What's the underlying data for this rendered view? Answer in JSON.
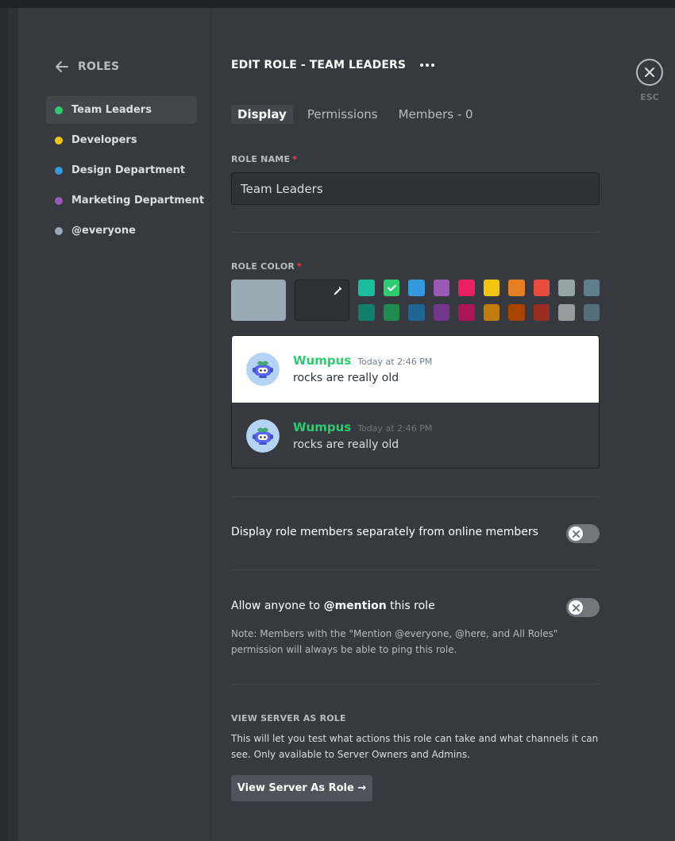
{
  "sidebar": {
    "back_label": "ROLES",
    "roles": [
      {
        "name": "Team Leaders",
        "color": "#2ecc71",
        "selected": true
      },
      {
        "name": "Developers",
        "color": "#f1c40f",
        "selected": false
      },
      {
        "name": "Design Department",
        "color": "#3498db",
        "selected": false
      },
      {
        "name": "Marketing Department",
        "color": "#9b59b6",
        "selected": false
      },
      {
        "name": "@everyone",
        "color": "#99aab5",
        "selected": false
      }
    ]
  },
  "header": {
    "title": "EDIT ROLE - TEAM LEADERS",
    "close_label": "ESC"
  },
  "tabs": [
    {
      "label": "Display",
      "active": true
    },
    {
      "label": "Permissions",
      "active": false
    },
    {
      "label": "Members - 0",
      "active": false
    }
  ],
  "role_name": {
    "label": "ROLE NAME",
    "required_mark": "*",
    "value": "Team Leaders"
  },
  "role_color": {
    "label": "ROLE COLOR",
    "required_mark": "*",
    "default_color": "#99aab5",
    "selected": "#2ecc71",
    "swatches_top": [
      "#1abc9c",
      "#2ecc71",
      "#3498db",
      "#9b59b6",
      "#e91e63",
      "#f1c40f",
      "#e67e22",
      "#e74c3c",
      "#95a5a6",
      "#607d8b"
    ],
    "swatches_bottom": [
      "#11806a",
      "#1f8b4c",
      "#206694",
      "#71368a",
      "#ad1457",
      "#c27c0e",
      "#a84300",
      "#992d22",
      "#979c9f",
      "#546e7a"
    ]
  },
  "preview": {
    "username": "Wumpus",
    "timestamp": "Today at 2:46 PM",
    "message": "rocks are really old"
  },
  "settings": {
    "hoist": {
      "label": "Display role members separately from online members",
      "enabled": false
    },
    "mentionable": {
      "label_prefix": "Allow anyone to ",
      "label_bold": "@mention",
      "label_suffix": " this role",
      "enabled": false,
      "note": "Note: Members with the \"Mention @everyone, @here, and All Roles\" permission will always be able to ping this role."
    }
  },
  "view_as_role": {
    "label": "VIEW SERVER AS ROLE",
    "description": "This will let you test what actions this role can take and what channels it can see. Only available to Server Owners and Admins.",
    "button_label": "View Server As Role →"
  }
}
